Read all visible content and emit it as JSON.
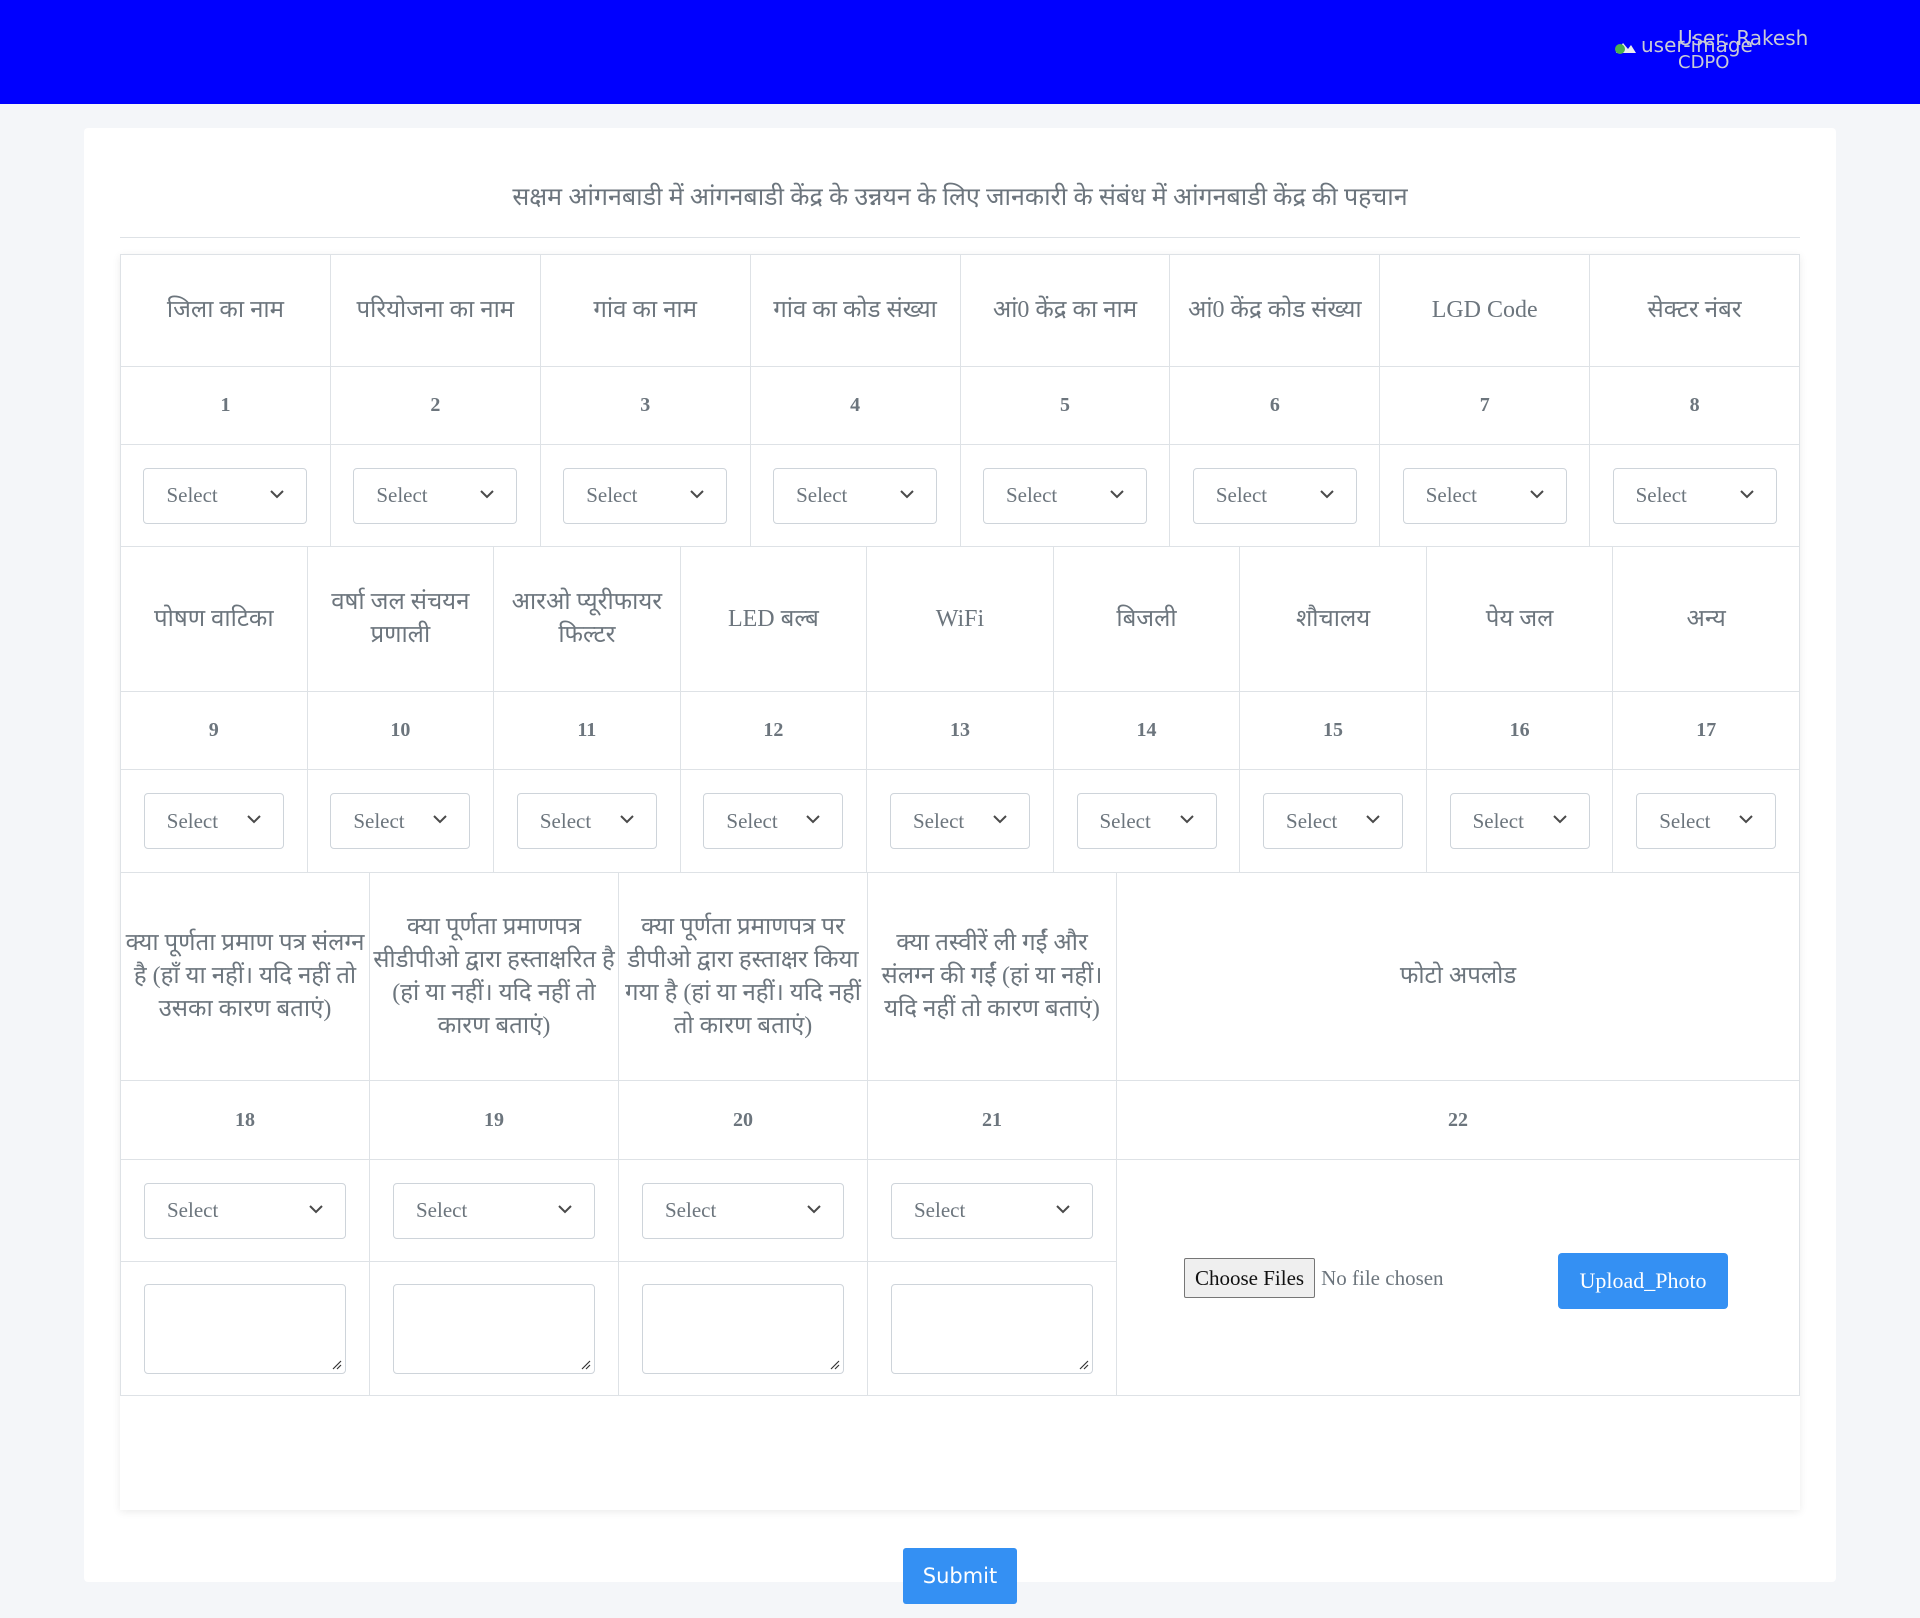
{
  "header": {
    "user_image_alt": "user-image",
    "user_name": "User: Rakesh",
    "user_role": "CDPO",
    "bg_color": "#0000ff"
  },
  "form": {
    "title": "सक्षम आंगनबाडी में आंगनबाडी केंद्र के उन्नयन के लिए जानकारी के संबंध में आंगनबाडी केंद्र की पहचान",
    "select_placeholder": "Select",
    "section1": {
      "headers": [
        "जिला का नाम",
        "परियोजना का नाम",
        "गांव का नाम",
        "गांव का कोड संख्या",
        "आं0 केंद्र का नाम",
        "आं0 केंद्र कोड संख्या",
        "LGD Code",
        "सेक्टर नंबर"
      ],
      "numbers": [
        "1",
        "2",
        "3",
        "4",
        "5",
        "6",
        "7",
        "8"
      ]
    },
    "section2": {
      "headers": [
        "पोषण वाटिका",
        "वर्षा जल संचयन प्रणाली",
        "आरओ प्यूरीफायर फिल्टर",
        "LED बल्ब",
        "WiFi",
        "बिजली",
        "शौचालय",
        "पेय जल",
        "अन्य"
      ],
      "numbers": [
        "9",
        "10",
        "11",
        "12",
        "13",
        "14",
        "15",
        "16",
        "17"
      ]
    },
    "section3": {
      "headers": [
        "क्या पूर्णता प्रमाण पत्र संलग्न है (हाँ या नहीं। यदि नहीं तो उसका कारण बताएं)",
        "क्या पूर्णता प्रमाणपत्र सीडीपीओ द्वारा हस्ताक्षरित है (हां या नहीं। यदि नहीं तो कारण बताएं)",
        "क्या पूर्णता प्रमाणपत्र पर डीपीओ द्वारा हस्ताक्षर किया गया है (हां या नहीं। यदि नहीं तो कारण बताएं)",
        "क्या तस्वीरें ली गईं और संलग्न की गईं (हां या नहीं। यदि नहीं तो कारण बताएं)"
      ],
      "numbers": [
        "18",
        "19",
        "20",
        "21"
      ],
      "photo_header": "फोटो अपलोड",
      "photo_number": "22"
    },
    "file_input": {
      "button_label": "Choose Files",
      "status": "No file chosen"
    },
    "upload_button": "Upload_Photo",
    "submit_button": "Submit",
    "accent_color": "#3490f3"
  }
}
